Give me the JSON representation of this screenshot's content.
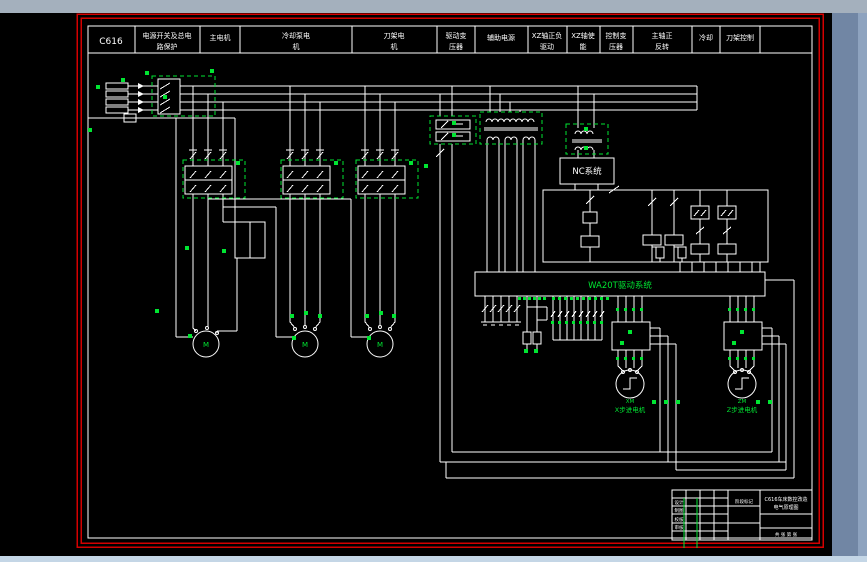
{
  "window": {
    "top_strip_color": "#a4b0bd",
    "right_band_color": "#7186a4",
    "right_edge_color": "#8ea3bf",
    "bottom_strip_color": "#c4d6e6",
    "canvas_color": "#000000",
    "frame_color": "#d40000",
    "line_color": "#ffffff",
    "accent_color": "#00e532"
  },
  "header": {
    "model": "C616",
    "columns": [
      {
        "line1": "电源开关及总电",
        "line2": "路保护"
      },
      {
        "line1": "主电机",
        "line2": ""
      },
      {
        "line1": "冷却泵电",
        "line2": "机"
      },
      {
        "line1": "刀架电",
        "line2": "机"
      },
      {
        "line1": "驱动变",
        "line2": "压器"
      },
      {
        "line1": "辅助电源",
        "line2": ""
      },
      {
        "line1": "XZ轴正负",
        "line2": "驱动"
      },
      {
        "line1": "XZ轴使",
        "line2": "能"
      },
      {
        "line1": "控制变",
        "line2": "压器"
      },
      {
        "line1": "主轴正",
        "line2": "反转"
      },
      {
        "line1": "冷却",
        "line2": ""
      },
      {
        "line1": "刀架控制",
        "line2": ""
      }
    ]
  },
  "diagram": {
    "nc_system_label": "NC系统",
    "drive_system_label": "WA20T驱动系统",
    "motor_symbol": "M",
    "stepper_motors": [
      {
        "id": "XM",
        "label": "X步进电机"
      },
      {
        "id": "ZM",
        "label": "Z步进电机"
      }
    ]
  },
  "title_block": {
    "left_labels": [
      "设计",
      "制图",
      "校核",
      "审核"
    ],
    "stage_label": "阶段标记",
    "title_line1": "C616车床数控改造",
    "title_line2": "电气原理图",
    "sheet_label": "共 张 第 张"
  }
}
